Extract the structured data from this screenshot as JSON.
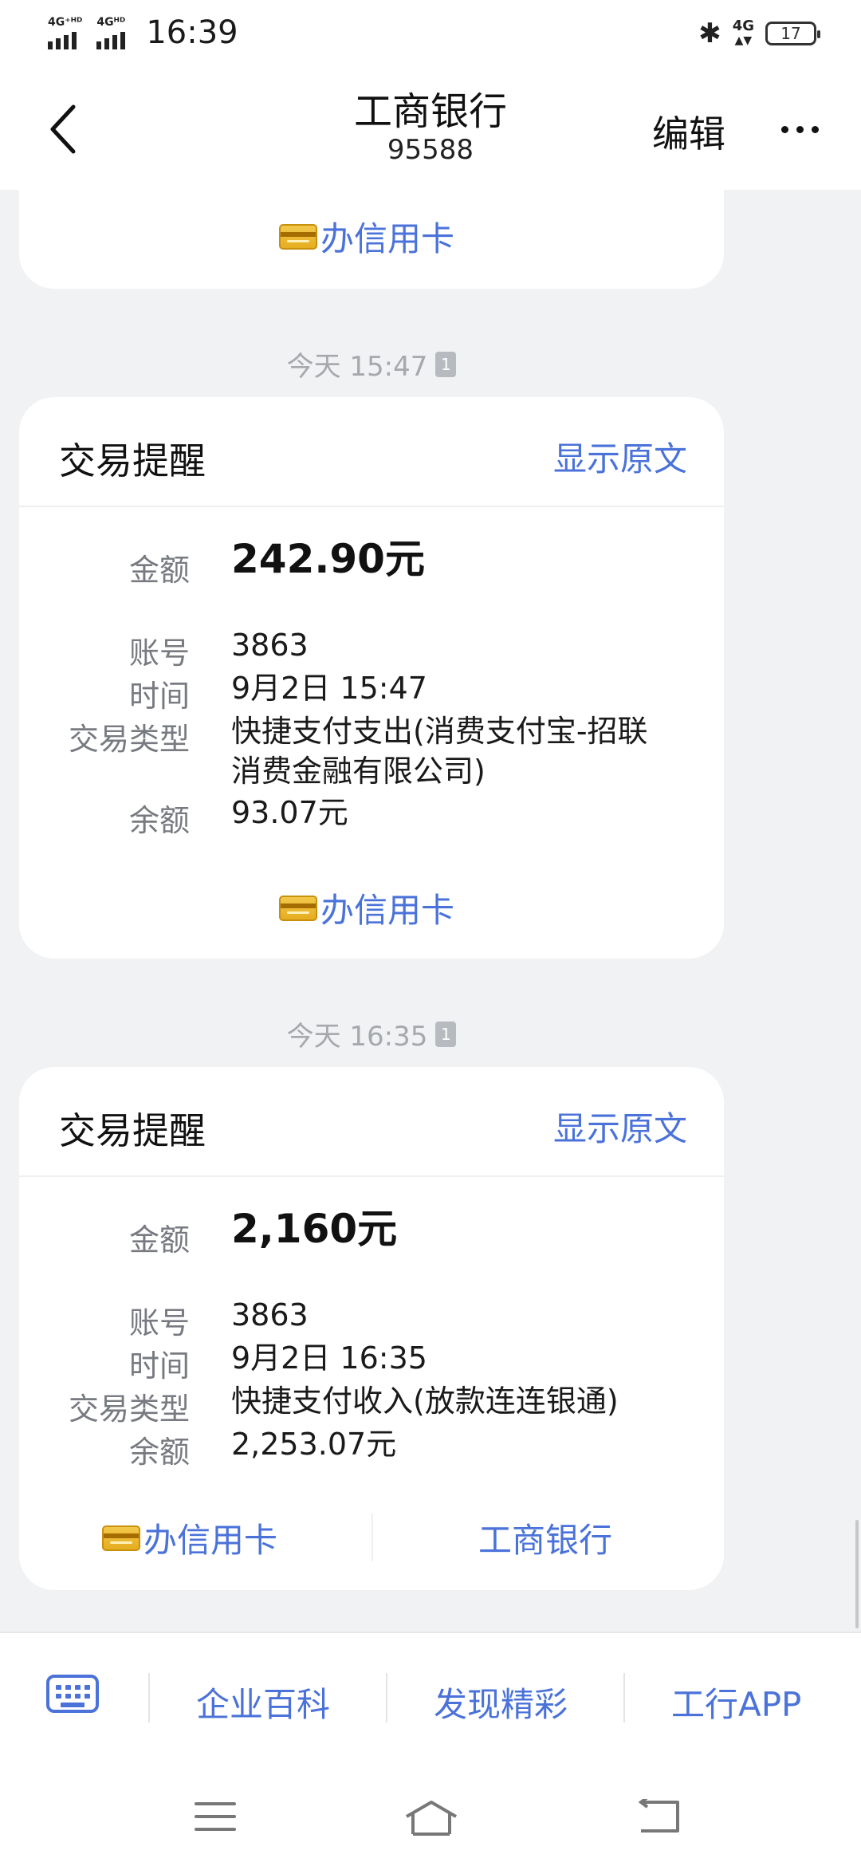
{
  "status_bar": {
    "signal1": "4G⁺ᴴᴰ",
    "signal2": "4Gᴴᴰ",
    "time": "16:39",
    "network": "4G",
    "battery": "17"
  },
  "header": {
    "title": "工商银行",
    "subtitle": "95588",
    "edit_label": "编辑"
  },
  "messages": {
    "prev_card_action": "办信用卡",
    "msg1": {
      "timestamp": "今天 15:47",
      "sim": "1",
      "title": "交易提醒",
      "show_original": "显示原文",
      "labels": {
        "amount": "金额",
        "account": "账号",
        "time": "时间",
        "type": "交易类型",
        "balance": "余额"
      },
      "amount": "242.90元",
      "account": "3863",
      "time": "9月2日 15:47",
      "type": "快捷支付支出(消费支付宝-招联消费金融有限公司)",
      "balance": "93.07元",
      "action": "办信用卡"
    },
    "msg2": {
      "timestamp": "今天 16:35",
      "sim": "1",
      "title": "交易提醒",
      "show_original": "显示原文",
      "labels": {
        "amount": "金额",
        "account": "账号",
        "time": "时间",
        "type": "交易类型",
        "balance": "余额"
      },
      "amount": "2,160元",
      "account": "3863",
      "time": "9月2日 16:35",
      "type": "快捷支付收入(放款连连银通)",
      "balance": "2,253.07元",
      "action1": "办信用卡",
      "action2": "工商银行"
    }
  },
  "bottom_menu": {
    "item1": "企业百科",
    "item2": "发现精彩",
    "item3": "工行APP"
  },
  "colors": {
    "link": "#4a72d9",
    "background": "#f1f2f4"
  }
}
